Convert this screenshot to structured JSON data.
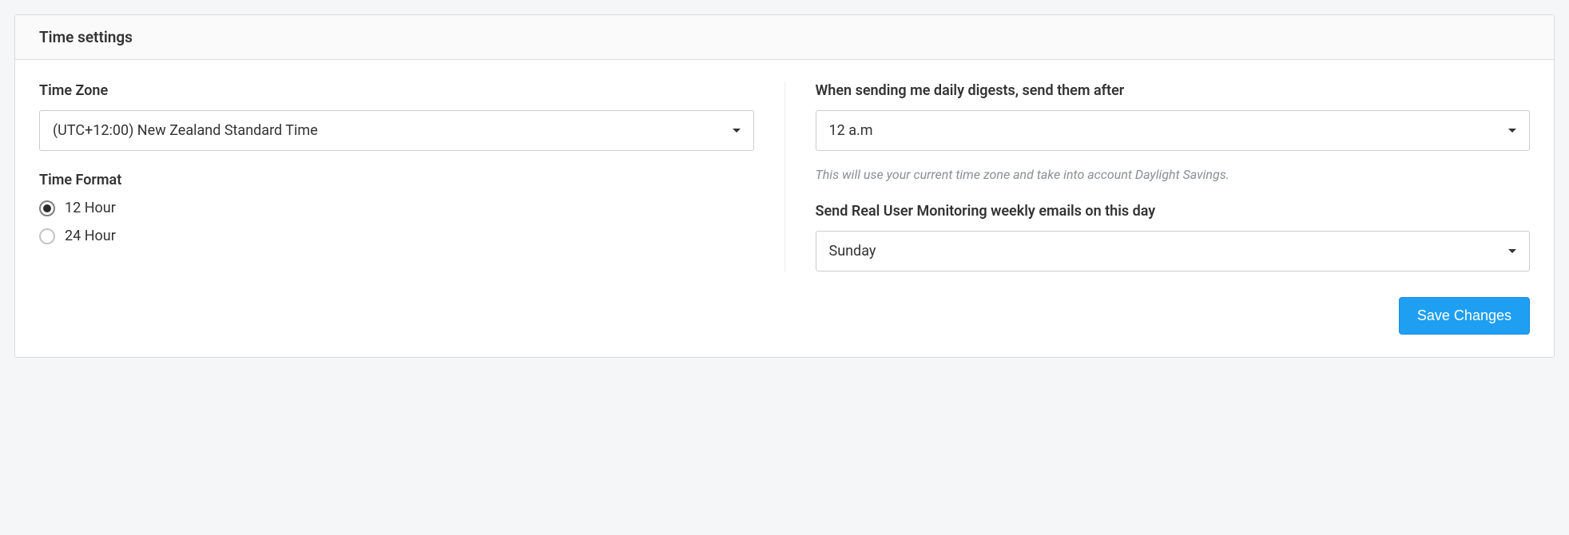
{
  "panel": {
    "title": "Time settings"
  },
  "left": {
    "timezone_label": "Time Zone",
    "timezone_value": "(UTC+12:00) New Zealand Standard Time",
    "timeformat_label": "Time Format",
    "option_12": "12 Hour",
    "option_24": "24 Hour",
    "selected_format": "12"
  },
  "right": {
    "digest_label": "When sending me daily digests, send them after",
    "digest_value": "12 a.m",
    "digest_helper": "This will use your current time zone and take into account Daylight Savings.",
    "rum_label": "Send Real User Monitoring weekly emails on this day",
    "rum_value": "Sunday"
  },
  "actions": {
    "save_label": "Save Changes"
  }
}
